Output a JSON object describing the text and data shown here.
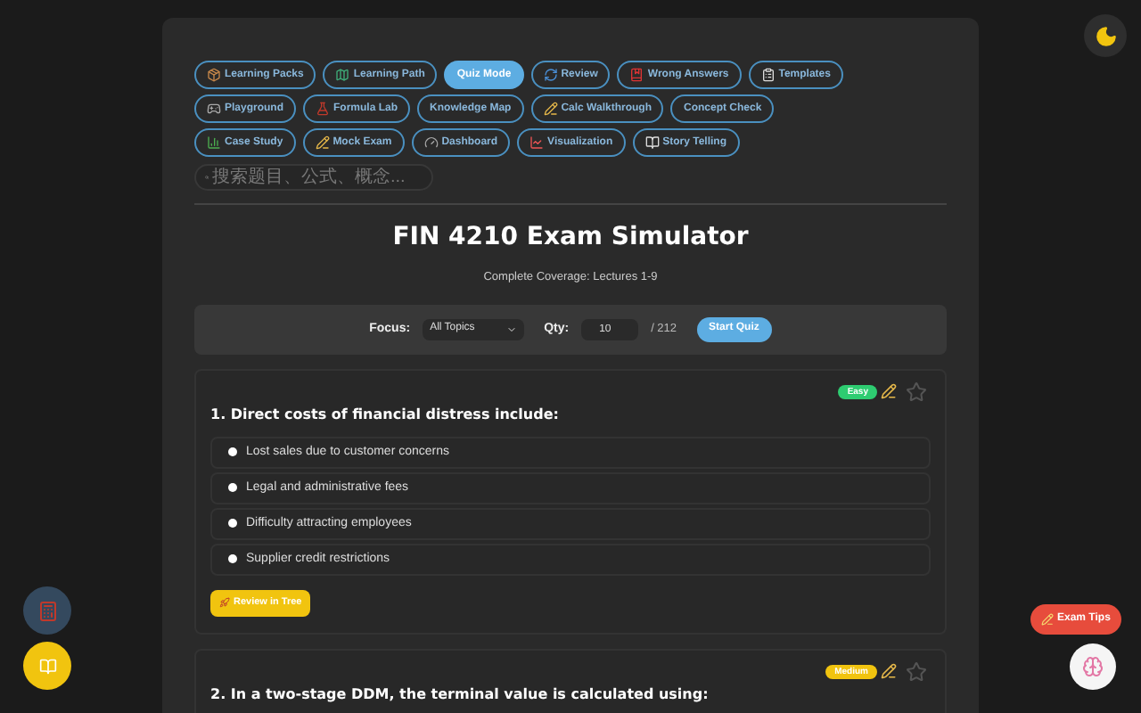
{
  "nav": [
    {
      "label": "Learning Packs",
      "selected": false
    },
    {
      "label": "Learning Path",
      "selected": false
    },
    {
      "label": "Quiz Mode",
      "selected": true
    },
    {
      "label": "Review",
      "selected": false
    },
    {
      "label": "Wrong Answers",
      "selected": false
    },
    {
      "label": "Templates",
      "selected": false
    },
    {
      "label": "Playground",
      "selected": false
    },
    {
      "label": "Formula Lab",
      "selected": false
    },
    {
      "label": "Knowledge Map",
      "selected": false
    },
    {
      "label": "Calc Walkthrough",
      "selected": false
    },
    {
      "label": "Concept Check",
      "selected": false
    },
    {
      "label": "Case Study",
      "selected": false
    },
    {
      "label": "Mock Exam",
      "selected": false
    },
    {
      "label": "Dashboard",
      "selected": false
    },
    {
      "label": "Visualization",
      "selected": false
    },
    {
      "label": "Story Telling",
      "selected": false
    }
  ],
  "search": {
    "placeholder": "搜索题目、公式、概念..."
  },
  "title": "FIN 4210 Exam Simulator",
  "subtitle": "Complete Coverage: Lectures 1-9",
  "controls": {
    "focus_label": "Focus:",
    "focus_value": "All Topics",
    "qty_label": "Qty:",
    "qty_value": "10",
    "total": "/ 212",
    "start": "Start Quiz"
  },
  "questions": [
    {
      "question": "1. Direct costs of financial distress include:",
      "difficulty": "Easy",
      "color": "#2ecc71",
      "starred": false,
      "options": [
        "Lost sales due to customer concerns",
        "Legal and administrative fees",
        "Difficulty attracting employees",
        "Supplier credit restrictions"
      ],
      "action": "Review in Tree"
    },
    {
      "question": "2. In a two-stage DDM, the terminal value is calculated using:",
      "difficulty": "Medium",
      "color": "#f1c40f",
      "starred": false
    }
  ],
  "exam_tips": "Exam Tips"
}
